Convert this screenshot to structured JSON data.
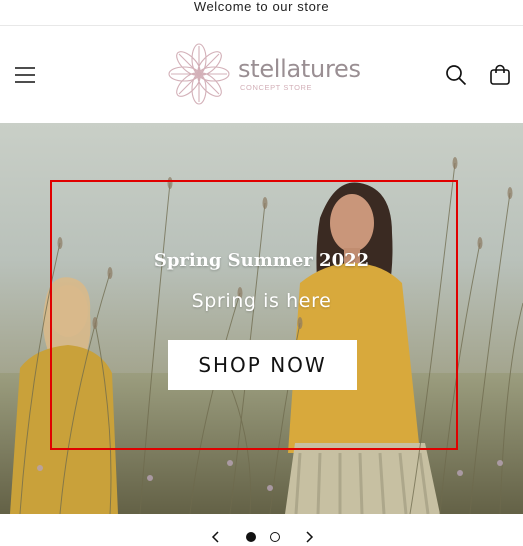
{
  "announcement": {
    "text": "Welcome to our store"
  },
  "header": {
    "logo": {
      "name": "stellatures",
      "tagline": "CONCEPT STORE"
    },
    "icons": [
      "hamburger-menu-icon",
      "search-icon",
      "cart-icon"
    ]
  },
  "slideshow": {
    "heading": "Spring Summer 2022",
    "subheading": "Spring is here",
    "button_label": "SHOP NOW",
    "current_slide": 1,
    "slide_count": 2
  },
  "colors": {
    "highlight_border": "#e00000",
    "logo_text": "#9a8f93",
    "logo_accent": "#d3b0b8",
    "text": "#121212"
  }
}
